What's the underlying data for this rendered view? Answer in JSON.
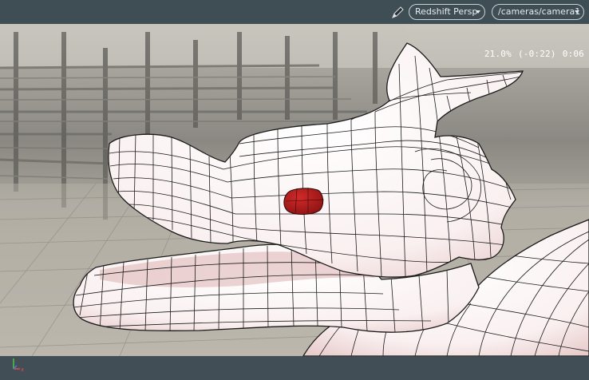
{
  "viewport_toolbar": {
    "renderer_label": "Redshift Persp",
    "camera_label": "/cameras/camera1",
    "icons": {
      "pencil": "pencil-icon",
      "axis": "axis-gizmo-icon"
    }
  },
  "hud": {
    "zoom": "21.0%",
    "time_offset": "(-0:22)",
    "time": "0:06"
  },
  "colors": {
    "toolbar_bg": "#3f4d55",
    "model_fill": "#fbf1f1",
    "model_shade": "#e3c4c4",
    "eye": "#b01e1e",
    "wire": "#1b1b1b"
  }
}
